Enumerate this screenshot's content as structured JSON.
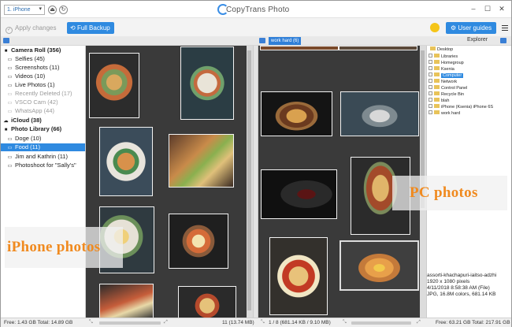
{
  "app": {
    "title": "CopyTrans Photo"
  },
  "device": {
    "selected": "1. iPhone"
  },
  "toolbar": {
    "apply_label": "Apply changes",
    "backup_label": "Full Backup",
    "guides_label": "User guides"
  },
  "pc_tab": {
    "label": "work hard (6)"
  },
  "explorer": {
    "label": "Explorer"
  },
  "sidebar": {
    "items": [
      {
        "label": "Camera Roll (356)",
        "icon": "camera-icon",
        "type": "group"
      },
      {
        "label": "Selfies (45)",
        "icon": "folder-icon",
        "type": "child"
      },
      {
        "label": "Screenshots (11)",
        "icon": "folder-icon",
        "type": "child"
      },
      {
        "label": "Videos (10)",
        "icon": "folder-icon",
        "type": "child"
      },
      {
        "label": "Live Photos (1)",
        "icon": "folder-icon",
        "type": "child"
      },
      {
        "label": "Recently Deleted (17)",
        "icon": "folder-icon",
        "type": "child-dim"
      },
      {
        "label": "VSCO Cam (42)",
        "icon": "folder-icon",
        "type": "child-dim"
      },
      {
        "label": "WhatsApp (44)",
        "icon": "folder-icon",
        "type": "child-dim"
      },
      {
        "label": "iCloud (38)",
        "icon": "cloud-icon",
        "type": "group"
      },
      {
        "label": "Photo Library (66)",
        "icon": "camera-icon",
        "type": "group"
      },
      {
        "label": "Doge (10)",
        "icon": "folder-icon",
        "type": "child"
      },
      {
        "label": "Food (11)",
        "icon": "folder-icon",
        "type": "child-selected"
      },
      {
        "label": "Jim and Kathrin (11)",
        "icon": "folder-icon",
        "type": "child"
      },
      {
        "label": "Photoshoot for \"Sally's\"",
        "icon": "folder-icon",
        "type": "child"
      }
    ]
  },
  "tree": {
    "items": [
      {
        "label": "Desktop",
        "level": 0
      },
      {
        "label": "Libraries",
        "level": 1
      },
      {
        "label": "Homegroup",
        "level": 1
      },
      {
        "label": "Ksenia",
        "level": 1
      },
      {
        "label": "Computer",
        "level": 1,
        "selected": true
      },
      {
        "label": "Network",
        "level": 1
      },
      {
        "label": "Control Panel",
        "level": 1
      },
      {
        "label": "Recycle Bin",
        "level": 1
      },
      {
        "label": "blah",
        "level": 1
      },
      {
        "label": "iPhone (Ksenia) iPhone 6S",
        "level": 1
      },
      {
        "label": "work hard",
        "level": 1
      }
    ]
  },
  "info": {
    "filename": "assorti-khachapuri-iaitso-adzhi",
    "dimensions": "1920 x 1080 pixels",
    "date": "4/11/2018 8:58:38 AM",
    "file_tag": "(File)",
    "format": "JPG, 16.8M colors, 681.14 KB"
  },
  "overlays": {
    "iphone": "iPhone photos",
    "pc": "PC photos"
  },
  "status": {
    "left_free": "Free: 1.43 GB Total: 14.89 GB",
    "iphone_count": "11 (13.74 MB)",
    "pc_count": "1 / 8 (681.14 KB / 9.10 MB)",
    "right_free": "Free: 63.21 GB Total: 217.91 GB"
  },
  "colors": {
    "accent": "#2f8ae0",
    "overlay_text": "#f08a1f",
    "panel_bg": "#3a3a3a"
  }
}
